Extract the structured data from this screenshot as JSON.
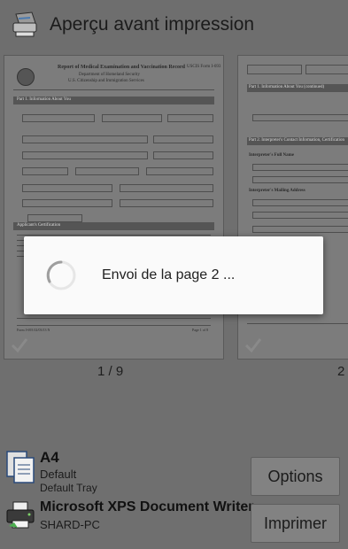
{
  "header": {
    "title": "Aperçu avant impression",
    "icon": "scanner-printer-icon"
  },
  "preview": {
    "page_a": {
      "counter": "1 / 9",
      "doc_title": "Report of Medical Examination and Vaccination Record",
      "doc_dept": "Department of Homeland Security",
      "doc_agency": "U.S. Citizenship and Immigration Services",
      "form_id": "USCIS Form I-693",
      "part1": "Part 1. Information About You",
      "cert": "Applicant's Certification",
      "footer_left": "Form I-693 02/03/13 N",
      "footer_right": "Page 1 of 8"
    },
    "page_b": {
      "counter": "2",
      "part1_cont": "Part 1. Information About You (continued)",
      "part2": "Part 2. Interpreter's Contact Information, Certification",
      "interp_name": "Interpreter's Full Name",
      "interp_addr": "Interpreter's Mailing Address"
    }
  },
  "dialog": {
    "message": "Envoi de la page 2 ..."
  },
  "paper": {
    "size": "A4",
    "line1": "Default",
    "line2": "Default Tray"
  },
  "printer": {
    "name": "Microsoft XPS Document Writer",
    "host": "SHARD-PC"
  },
  "buttons": {
    "options": "Options",
    "print": "Imprimer"
  }
}
